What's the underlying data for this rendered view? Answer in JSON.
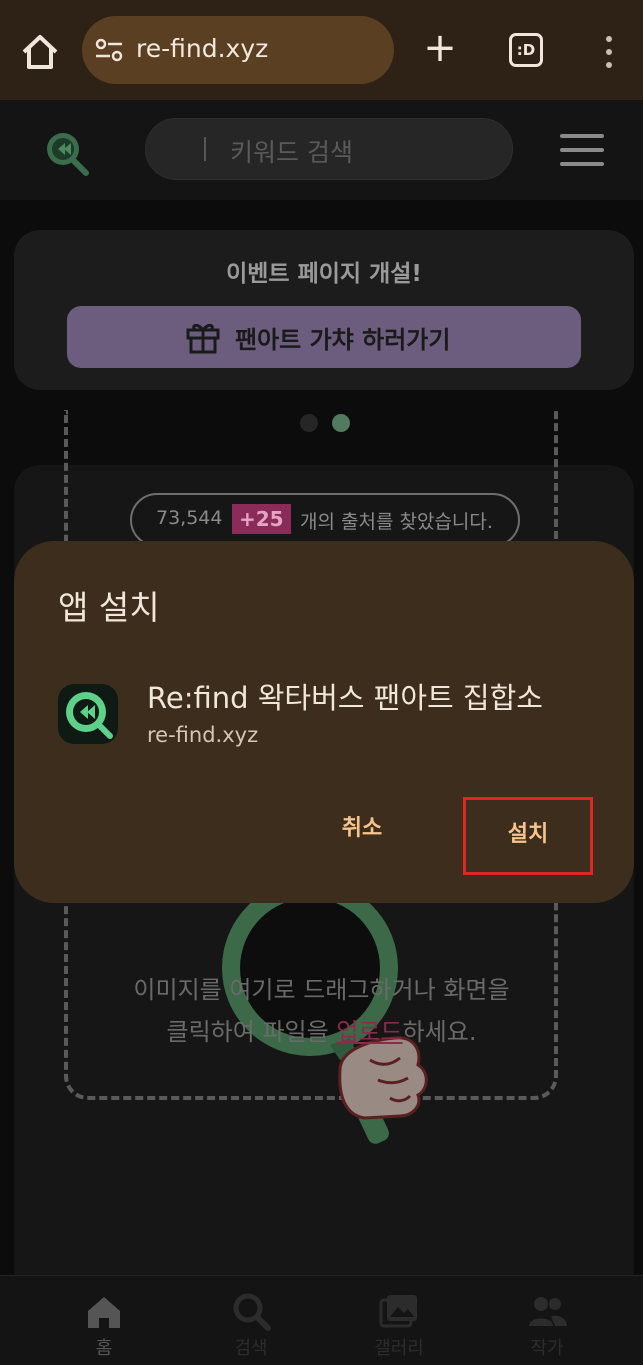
{
  "browser": {
    "url": "re-find.xyz",
    "tabs_label": ":D",
    "colors": {
      "toolbar": "#2e2116",
      "url_box": "#5a3f22"
    },
    "icons": [
      "home-icon",
      "site-settings-icon",
      "plus-icon",
      "tabs-icon",
      "more-vert-icon"
    ]
  },
  "site": {
    "search_placeholder": "키워드 검색",
    "icons": [
      "refind-logo-icon",
      "hamburger-menu-icon"
    ]
  },
  "event_banner": {
    "title": "이벤트 페이지 개설!",
    "button_label": "팬아트 가챠 하러가기",
    "button_color": "#6c5d7e",
    "carousel": {
      "total": 2,
      "active": 2
    }
  },
  "counter": {
    "total": "73,544",
    "delta": "+25",
    "suffix": "개의 출처를 찾았습니다."
  },
  "upload": {
    "text_line1": "이미지를 여기로 드래그하거나 화면을",
    "text_before_link": "클릭하여 파일을 ",
    "link": "업로드",
    "text_after_link": "하세요."
  },
  "bottom_nav": [
    {
      "label": "홈",
      "icon": "home-icon",
      "active": true
    },
    {
      "label": "검색",
      "icon": "search-icon",
      "active": false
    },
    {
      "label": "갤러리",
      "icon": "gallery-icon",
      "active": false
    },
    {
      "label": "작가",
      "icon": "artist-icon",
      "active": false
    }
  ],
  "dialog": {
    "title": "앱 설치",
    "app_name": "Re:find 왁타버스 팬아트 집합소",
    "app_url": "re-find.xyz",
    "cancel_label": "취소",
    "install_label": "설치",
    "highlight_color": "#e02525",
    "background_color": "#3d2d1c",
    "button_text_color": "#f6c48f"
  }
}
